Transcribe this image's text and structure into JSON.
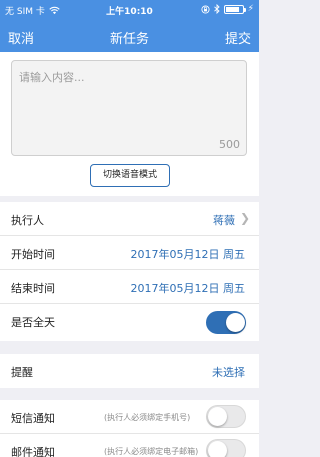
{
  "status_bar": {
    "carrier": "无 SIM 卡",
    "wifi_icon": "wifi-icon",
    "time": "上午10:10",
    "battery_level": 0.8,
    "battery_color": "#ffffff"
  },
  "nav": {
    "cancel_label": "取消",
    "title": "新任务",
    "submit_label": "提交",
    "background": "#4a90e2"
  },
  "editor": {
    "placeholder": "请输入内容...",
    "remaining_count": "500",
    "voice_mode_button": "切换语音模式"
  },
  "form": {
    "executor_label": "执行人",
    "executor_value": "蒋薇",
    "start_label": "开始时间",
    "start_value": "2017年05月12日 周五",
    "end_label": "结束时间",
    "end_value": "2017年05月12日 周五",
    "all_day_label": "是否全天",
    "all_day_on": true
  },
  "reminder": {
    "label": "提醒",
    "value": "未选择"
  },
  "notify": {
    "sms_label": "短信通知",
    "sms_hint": "(执行人必须绑定手机号)",
    "sms_on": false,
    "email_label": "邮件通知",
    "email_hint": "(执行人必须绑定电子邮箱)",
    "email_on": false
  },
  "colors": {
    "accent": "#2f6fb5",
    "background": "#efeff4"
  }
}
